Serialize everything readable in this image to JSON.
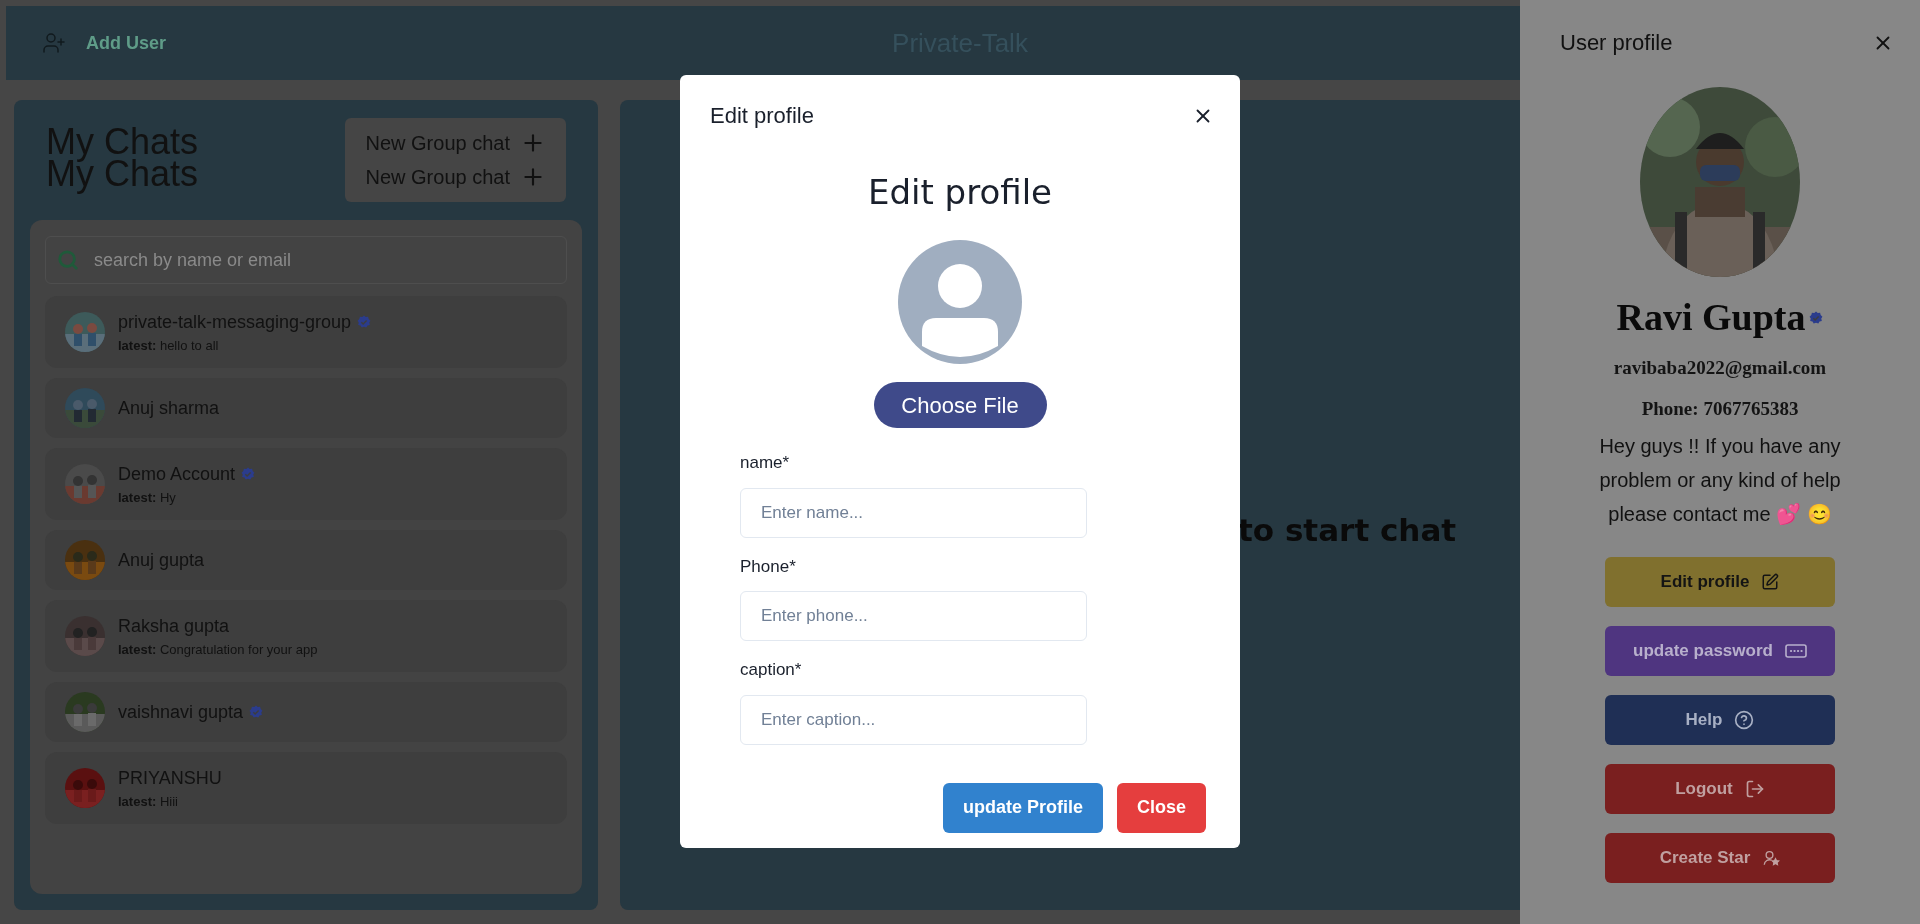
{
  "header": {
    "add_user": "Add User",
    "title": "Private-Talk"
  },
  "chats_panel": {
    "titles": [
      "My Chats",
      "My Chats"
    ],
    "new_group_buttons": [
      "New Group chat",
      "New Group chat"
    ],
    "search": {
      "placeholder": "search by name or email"
    },
    "chats": [
      {
        "name": "private-talk-messaging-group",
        "verified": true,
        "latest": "**latest:** hello to all"
      },
      {
        "name": "Anuj sharma",
        "verified": false
      },
      {
        "name": "Demo Account",
        "verified": true,
        "latest": "**latest:** Hy"
      },
      {
        "name": "Anuj gupta",
        "verified": false
      },
      {
        "name": "Raksha gupta",
        "verified": false,
        "latest": "**latest:** Congratulation for your app"
      },
      {
        "name": "vaishnavi gupta",
        "verified": true
      },
      {
        "name": "PRIYANSHU",
        "verified": false,
        "latest": "**latest:** Hiii"
      }
    ]
  },
  "chat_area": {
    "hint": "to start chat"
  },
  "modal": {
    "title": "Edit profile",
    "heading": "Edit profile",
    "choose_file": "Choose File",
    "fields": [
      {
        "label": "name*",
        "placeholder": "Enter name..."
      },
      {
        "label": "Phone*",
        "placeholder": "Enter phone..."
      },
      {
        "label": "caption*",
        "placeholder": "Enter caption..."
      }
    ],
    "buttons": [
      {
        "label": "update Profile",
        "kind": "primary"
      },
      {
        "label": "Close",
        "kind": "danger"
      }
    ]
  },
  "drawer": {
    "title": "User profile",
    "name": "Ravi Gupta",
    "verified": true,
    "email": "ravibaba2022@gmail.com",
    "phone": "Phone: 7067765383",
    "caption": "Hey guys !! If you have any problem or any kind of help please contact me 💕 😊",
    "buttons": [
      {
        "label": "Edit profile",
        "kind": "edit"
      },
      {
        "label": "update password",
        "kind": "password"
      },
      {
        "label": "Help",
        "kind": "help"
      },
      {
        "label": "Logout",
        "kind": "logout"
      },
      {
        "label": "Create Star",
        "kind": "star"
      }
    ]
  }
}
